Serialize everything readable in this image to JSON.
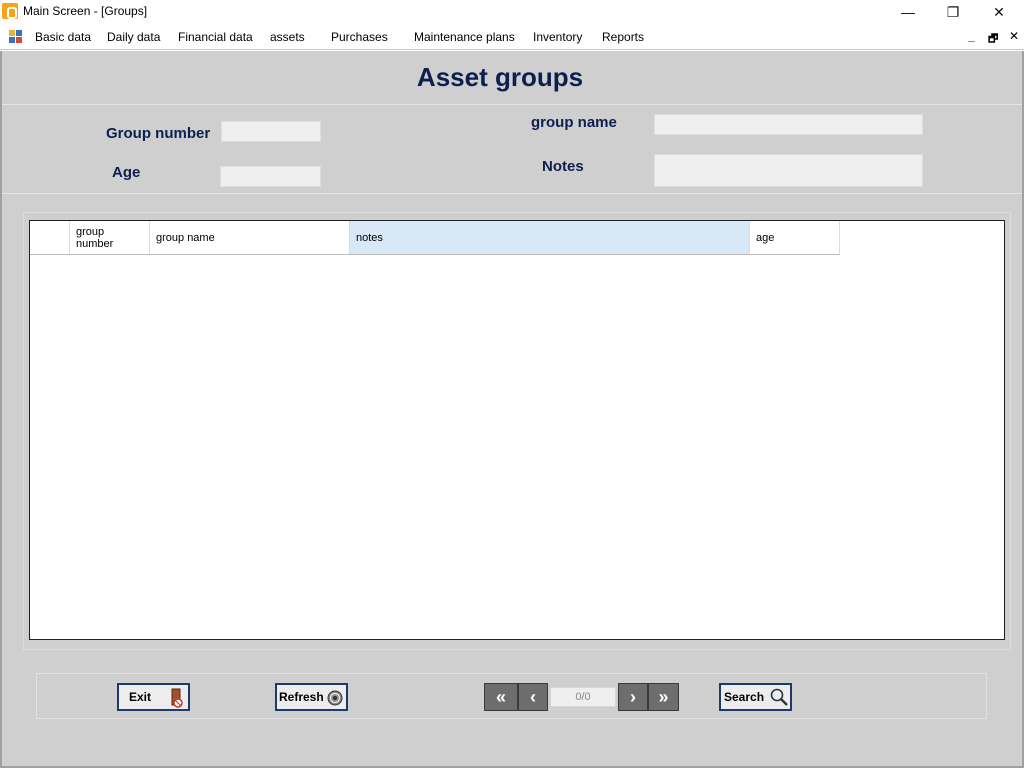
{
  "window": {
    "title": "Main Screen - [Groups]",
    "minimize": "—",
    "restore": "❐",
    "close": "✕"
  },
  "menu": {
    "items": [
      "Basic data",
      "Daily data",
      "Financial data",
      "assets",
      "Purchases",
      "Maintenance plans",
      "Inventory",
      "Reports"
    ],
    "mdi_min": "_",
    "mdi_restore": "🗗",
    "mdi_close": "✕"
  },
  "form": {
    "title": "Asset groups",
    "group_number_label": "Group number",
    "group_number_value": "",
    "group_name_label": "group name",
    "group_name_value": "",
    "age_label": "Age",
    "age_value": "",
    "notes_label": "Notes",
    "notes_value": ""
  },
  "grid": {
    "columns": [
      "",
      "group\nnumber",
      "group name",
      "notes",
      "age"
    ],
    "rows": []
  },
  "buttons": {
    "exit": "Exit",
    "refresh": "Refresh",
    "search": "Search"
  },
  "nav": {
    "first": "«",
    "prev": "‹",
    "next": "›",
    "last": "»",
    "position": "0/0"
  },
  "colors": {
    "title_navy": "#0d1f4f",
    "client_gray": "#cfcfcf",
    "selected_header": "#d9e8f7"
  }
}
